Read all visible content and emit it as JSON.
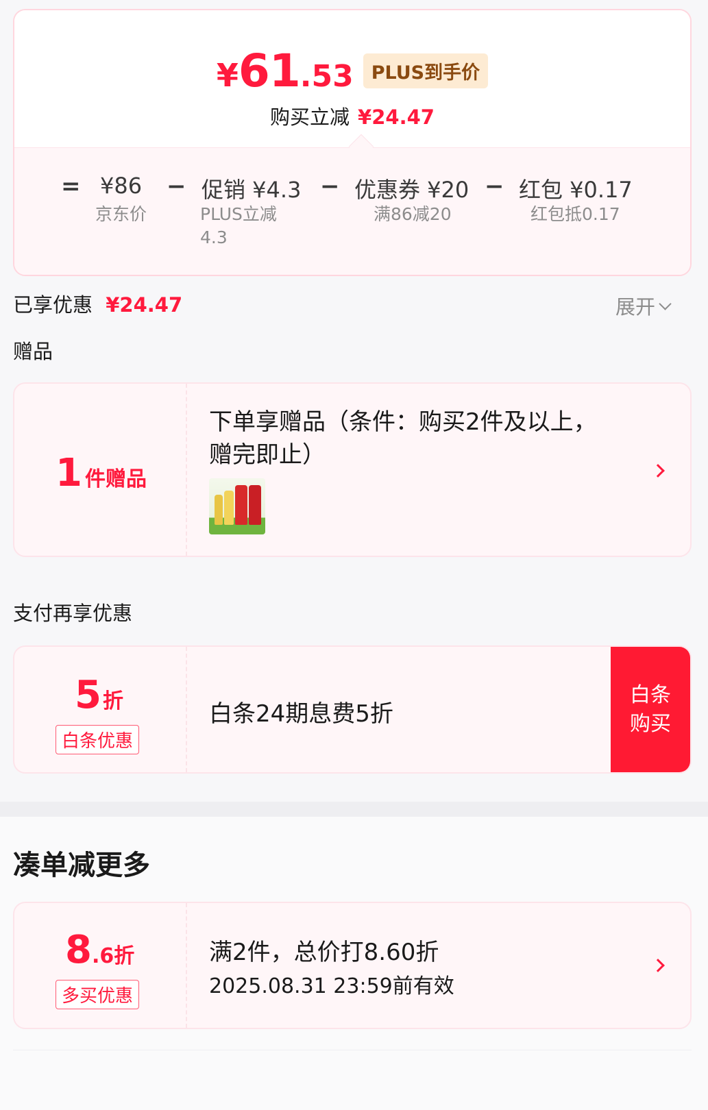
{
  "price_card": {
    "currency": "¥",
    "price_int": "61",
    "price_dec": ".53",
    "plus_tag": "PLUS到手价",
    "saving_label": "购买立减",
    "saving_amount": "¥24.47",
    "equals": "=",
    "minus": "−",
    "items": [
      {
        "value": "¥86",
        "sub": "京东价"
      },
      {
        "value": "促销 ¥4.3",
        "sub": "PLUS立减\n4.3",
        "sub1": "PLUS立减",
        "sub2": "4.3"
      },
      {
        "value": "优惠券 ¥20",
        "sub": "满86减20"
      },
      {
        "value": "红包 ¥0.17",
        "sub": "红包抵0.17"
      }
    ]
  },
  "enjoyed": {
    "label": "已享优惠",
    "amount": "¥24.47",
    "expand": "展开"
  },
  "gifts": {
    "heading": "赠品",
    "count": "1",
    "count_unit": "件赠品",
    "title_line1": "下单享赠品（条件：购买2件及以上，",
    "title_line2": "赠完即止）"
  },
  "pay_offer": {
    "heading": "支付再享优惠",
    "discount": "5",
    "discount_unit": "折",
    "badge": "白条优惠",
    "title": "白条24期息费5折",
    "button_line1": "白条",
    "button_line2": "购买"
  },
  "bundle": {
    "heading": "凑单减更多",
    "discount_int": "8",
    "discount_dec": ".6",
    "discount_unit": "折",
    "badge": "多买优惠",
    "title": "满2件，总价打8.60折",
    "validity": "2025.08.31 23:59前有效"
  },
  "colors": {
    "accent": "#ff1a3d",
    "plus_tag_bg": "#fdebd3",
    "plus_tag_text": "#8a4a10",
    "card_bg": "#fff6f8"
  }
}
